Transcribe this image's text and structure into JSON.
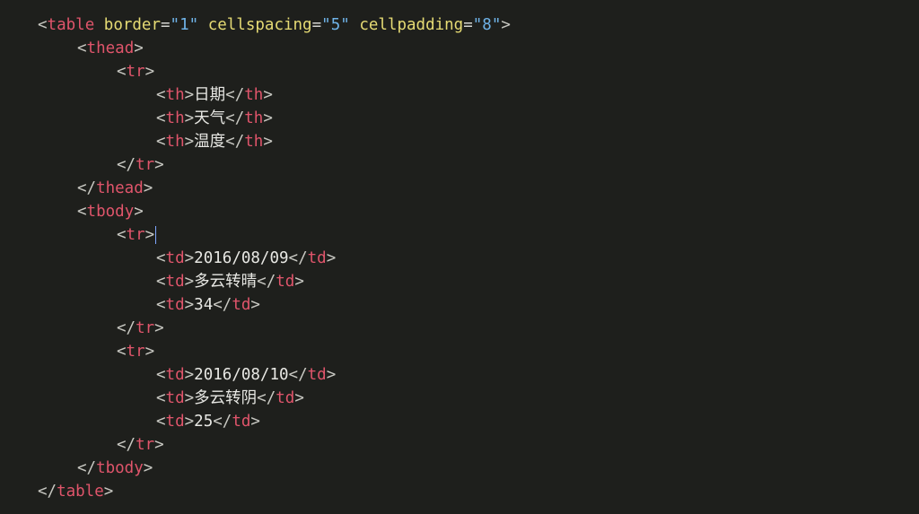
{
  "editor": {
    "lines": [
      {
        "indent": 0,
        "tokens": [
          [
            "b",
            "<"
          ],
          [
            "t",
            "table"
          ],
          [
            "s",
            " "
          ],
          [
            "a",
            "border"
          ],
          [
            "e",
            "="
          ],
          [
            "v",
            "\"1\""
          ],
          [
            "s",
            " "
          ],
          [
            "a",
            "cellspacing"
          ],
          [
            "e",
            "="
          ],
          [
            "v",
            "\"5\""
          ],
          [
            "s",
            " "
          ],
          [
            "a",
            "cellpadding"
          ],
          [
            "e",
            "="
          ],
          [
            "v",
            "\"8\""
          ],
          [
            "b",
            ">"
          ]
        ]
      },
      {
        "indent": 1,
        "tokens": [
          [
            "b",
            "<"
          ],
          [
            "t",
            "thead"
          ],
          [
            "b",
            ">"
          ]
        ]
      },
      {
        "indent": 2,
        "tokens": [
          [
            "b",
            "<"
          ],
          [
            "t",
            "tr"
          ],
          [
            "b",
            ">"
          ]
        ]
      },
      {
        "indent": 3,
        "tokens": [
          [
            "b",
            "<"
          ],
          [
            "t",
            "th"
          ],
          [
            "b",
            ">"
          ],
          [
            "x",
            "日期"
          ],
          [
            "b",
            "</"
          ],
          [
            "t",
            "th"
          ],
          [
            "b",
            ">"
          ]
        ]
      },
      {
        "indent": 3,
        "tokens": [
          [
            "b",
            "<"
          ],
          [
            "t",
            "th"
          ],
          [
            "b",
            ">"
          ],
          [
            "x",
            "天气"
          ],
          [
            "b",
            "</"
          ],
          [
            "t",
            "th"
          ],
          [
            "b",
            ">"
          ]
        ]
      },
      {
        "indent": 3,
        "tokens": [
          [
            "b",
            "<"
          ],
          [
            "t",
            "th"
          ],
          [
            "b",
            ">"
          ],
          [
            "x",
            "温度"
          ],
          [
            "b",
            "</"
          ],
          [
            "t",
            "th"
          ],
          [
            "b",
            ">"
          ]
        ]
      },
      {
        "indent": 2,
        "tokens": [
          [
            "b",
            "</"
          ],
          [
            "t",
            "tr"
          ],
          [
            "b",
            ">"
          ]
        ]
      },
      {
        "indent": 1,
        "tokens": [
          [
            "b",
            "</"
          ],
          [
            "t",
            "thead"
          ],
          [
            "b",
            ">"
          ]
        ]
      },
      {
        "indent": 1,
        "tokens": [
          [
            "b",
            "<"
          ],
          [
            "t",
            "tbody"
          ],
          [
            "b",
            ">"
          ]
        ]
      },
      {
        "indent": 2,
        "tokens": [
          [
            "b",
            "<"
          ],
          [
            "t",
            "tr"
          ],
          [
            "b",
            ">"
          ],
          [
            "c",
            ""
          ]
        ]
      },
      {
        "indent": 3,
        "tokens": [
          [
            "b",
            "<"
          ],
          [
            "t",
            "td"
          ],
          [
            "b",
            ">"
          ],
          [
            "x",
            "2016/08/09"
          ],
          [
            "b",
            "</"
          ],
          [
            "t",
            "td"
          ],
          [
            "b",
            ">"
          ]
        ]
      },
      {
        "indent": 3,
        "tokens": [
          [
            "b",
            "<"
          ],
          [
            "t",
            "td"
          ],
          [
            "b",
            ">"
          ],
          [
            "x",
            "多云转晴"
          ],
          [
            "b",
            "</"
          ],
          [
            "t",
            "td"
          ],
          [
            "b",
            ">"
          ]
        ]
      },
      {
        "indent": 3,
        "tokens": [
          [
            "b",
            "<"
          ],
          [
            "t",
            "td"
          ],
          [
            "b",
            ">"
          ],
          [
            "x",
            "34"
          ],
          [
            "b",
            "</"
          ],
          [
            "t",
            "td"
          ],
          [
            "b",
            ">"
          ]
        ]
      },
      {
        "indent": 2,
        "tokens": [
          [
            "b",
            "</"
          ],
          [
            "t",
            "tr"
          ],
          [
            "b",
            ">"
          ]
        ]
      },
      {
        "indent": 2,
        "tokens": [
          [
            "b",
            "<"
          ],
          [
            "t",
            "tr"
          ],
          [
            "b",
            ">"
          ]
        ]
      },
      {
        "indent": 3,
        "tokens": [
          [
            "b",
            "<"
          ],
          [
            "t",
            "td"
          ],
          [
            "b",
            ">"
          ],
          [
            "x",
            "2016/08/10"
          ],
          [
            "b",
            "</"
          ],
          [
            "t",
            "td"
          ],
          [
            "b",
            ">"
          ]
        ]
      },
      {
        "indent": 3,
        "tokens": [
          [
            "b",
            "<"
          ],
          [
            "t",
            "td"
          ],
          [
            "b",
            ">"
          ],
          [
            "x",
            "多云转阴"
          ],
          [
            "b",
            "</"
          ],
          [
            "t",
            "td"
          ],
          [
            "b",
            ">"
          ]
        ]
      },
      {
        "indent": 3,
        "tokens": [
          [
            "b",
            "<"
          ],
          [
            "t",
            "td"
          ],
          [
            "b",
            ">"
          ],
          [
            "x",
            "25"
          ],
          [
            "b",
            "</"
          ],
          [
            "t",
            "td"
          ],
          [
            "b",
            ">"
          ]
        ]
      },
      {
        "indent": 2,
        "tokens": [
          [
            "b",
            "</"
          ],
          [
            "t",
            "tr"
          ],
          [
            "b",
            ">"
          ]
        ]
      },
      {
        "indent": 1,
        "tokens": [
          [
            "b",
            "</"
          ],
          [
            "t",
            "tbody"
          ],
          [
            "b",
            ">"
          ]
        ]
      },
      {
        "indent": 0,
        "tokens": [
          [
            "b",
            "</"
          ],
          [
            "t",
            "table"
          ],
          [
            "b",
            ">"
          ]
        ]
      }
    ]
  },
  "colors": {
    "background": "#1e1f1c",
    "tag": "#e0556b",
    "attribute": "#e6db74",
    "value": "#6fb3e8",
    "bracket": "#c8c8c2",
    "text": "#e8e8e4",
    "caret": "#7fa7ff"
  }
}
